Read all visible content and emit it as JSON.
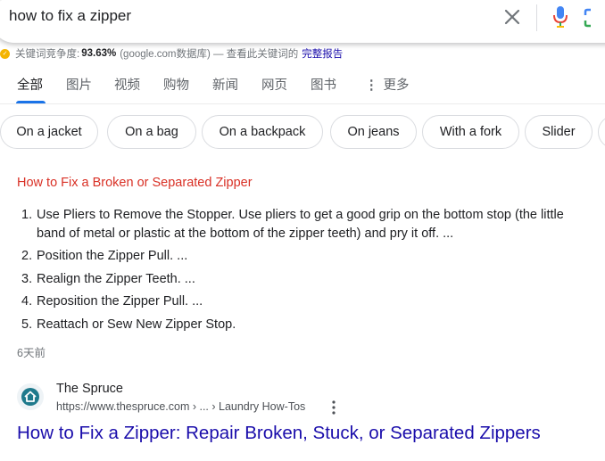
{
  "search": {
    "query": "how to fix a zipper",
    "icons": [
      "close-icon",
      "mic-icon",
      "lens-icon"
    ]
  },
  "keyword_bar": {
    "label": "关键词竞争度:",
    "percent": "93.63%",
    "source": "(google.com数据库) — 查看此关键词的",
    "report_link": "完整报告"
  },
  "tabs": [
    {
      "label": "全部",
      "active": true
    },
    {
      "label": "图片"
    },
    {
      "label": "视频"
    },
    {
      "label": "购物"
    },
    {
      "label": "新闻"
    },
    {
      "label": "网页"
    },
    {
      "label": "图书"
    },
    {
      "label": "更多",
      "icon": "more-vert-icon"
    }
  ],
  "chips": [
    "On a jacket",
    "On a bag",
    "On a backpack",
    "On jeans",
    "With a fork",
    "Slider"
  ],
  "snippet": {
    "title": "How to Fix a Broken or Separated Zipper",
    "steps": [
      {
        "num": "1.",
        "text": "Use Pliers to Remove the Stopper. Use pliers to get a good grip on the bottom stop (the little band of metal or plastic at the bottom of the zipper teeth) and pry it off. ..."
      },
      {
        "num": "2.",
        "text": "Position the Zipper Pull. ..."
      },
      {
        "num": "3.",
        "text": "Realign the Zipper Teeth. ..."
      },
      {
        "num": "4.",
        "text": "Reposition the Zipper Pull. ..."
      },
      {
        "num": "5.",
        "text": "Reattach or Sew New Zipper Stop."
      }
    ],
    "date": "6天前"
  },
  "result": {
    "site_name": "The Spruce",
    "url": "https://www.thespruce.com › ... › Laundry How-Tos",
    "title": "How to Fix a Zipper: Repair Broken, Stuck, or Separated Zippers"
  },
  "colors": {
    "link": "#1a0dab",
    "snippet_title": "#d93025",
    "active_tab": "#1a73e8"
  }
}
